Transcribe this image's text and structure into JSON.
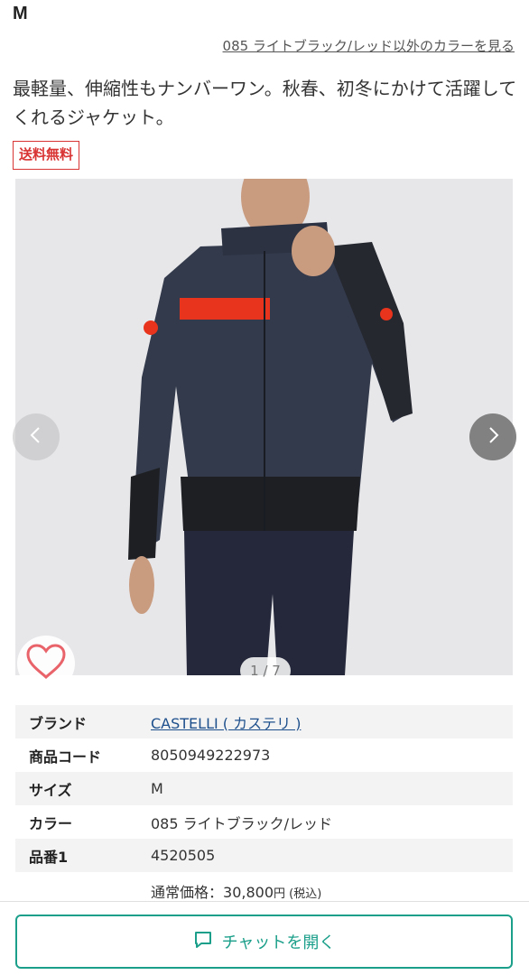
{
  "product": {
    "size": "M",
    "other_colors_link": "085 ライトブラック/レッド以外のカラーを見る",
    "description": "最軽量、伸縮性もナンバーワン。秋春、初冬にかけて活躍してくれるジャケット。",
    "badge": "送料無料"
  },
  "gallery": {
    "counter": "1 / 7",
    "icons": {
      "prev": "chevron-left-icon",
      "next": "chevron-right-icon",
      "favorite": "heart-icon"
    }
  },
  "specs": [
    {
      "label": "ブランド",
      "value": "CASTELLI ( カステリ )"
    },
    {
      "label": "商品コード",
      "value": "8050949222973"
    },
    {
      "label": "サイズ",
      "value": "M"
    },
    {
      "label": "カラー",
      "value": "085 ライトブラック/レッド"
    },
    {
      "label": "品番1",
      "value": "4520505"
    }
  ],
  "price": {
    "label": "通常価格：",
    "amount": "30,800",
    "currency": "円",
    "tax": " (税込)"
  },
  "chat": {
    "label": "チャットを開く",
    "icon": "chat-bubble-icon"
  },
  "colors": {
    "accent": "#1b9f8a",
    "badge": "#d93434",
    "link": "#1d4f8c"
  }
}
